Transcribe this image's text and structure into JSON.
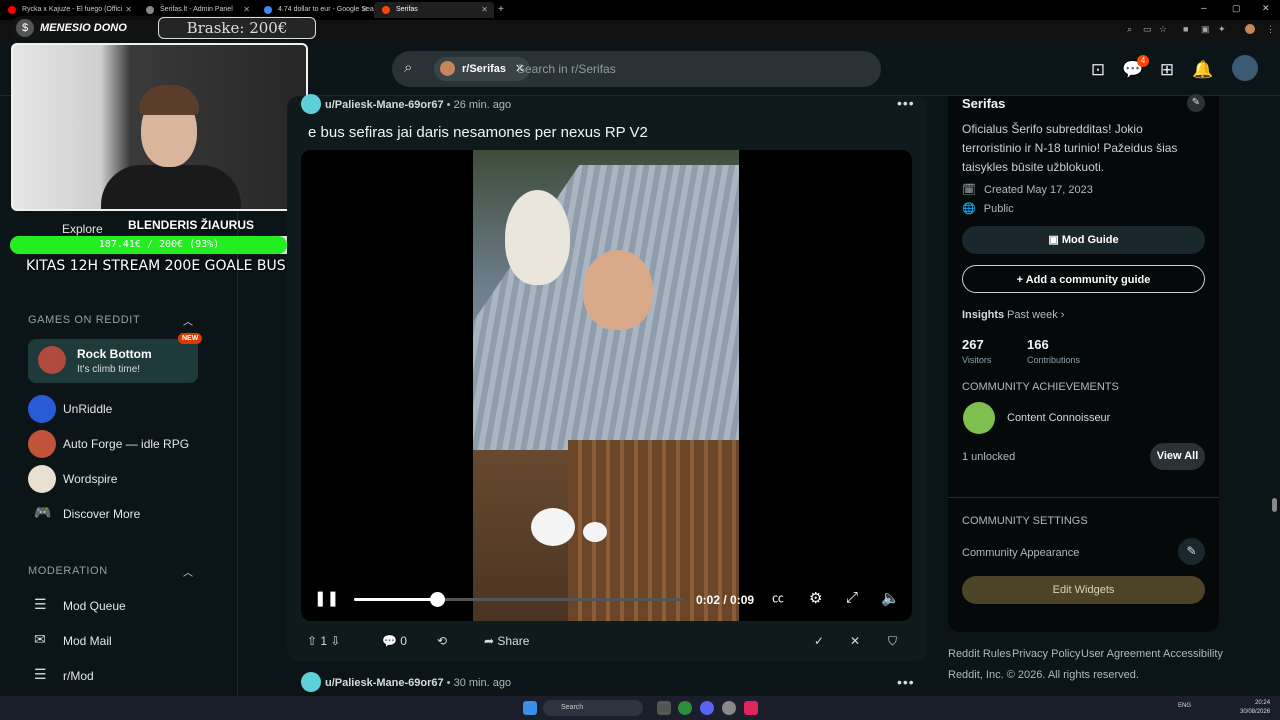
{
  "browser": {
    "tabs": [
      {
        "title": "Rycka x Kajuze - El fuego (Offici",
        "color": "#ff0000"
      },
      {
        "title": "Šerifas.lt - Admin Panel",
        "color": "#888888"
      },
      {
        "title": "4.74 dollar to eur - Google Sea",
        "color": "#4285f4"
      },
      {
        "title": "Serifas",
        "color": "#ff4500"
      }
    ],
    "new_tab": "+"
  },
  "header": {
    "search_chip": "r/Serifas",
    "search_placeholder": "Search in r/Serifas",
    "chat_badge": "4"
  },
  "stream_overlay": {
    "dono_label": "MENESIO DONO",
    "dono_amount": "Braske: 200€",
    "goal_title": "BLENDERIS ŽIAURUS",
    "goal_progress_text": "187.41€ / 200€ (93%)",
    "goal_fraction": 0.93,
    "banner": "KITAS 12H STREAM 200E GOALE BUS"
  },
  "sidebar": {
    "explore_label": "Explore",
    "games_title": "GAMES ON REDDIT",
    "featured_game": {
      "name": "Rock Bottom",
      "subtitle": "It's climb time!",
      "badge": "NEW"
    },
    "games": [
      {
        "name": "UnRiddle",
        "color": "#2a5bd7"
      },
      {
        "name": "Auto Forge — idle RPG",
        "color": "#c0533a"
      },
      {
        "name": "Wordspire",
        "color": "#e8e0d0"
      },
      {
        "name": "Discover More",
        "color": ""
      }
    ],
    "moderation_title": "MODERATION",
    "mod_items": [
      "Mod Queue",
      "Mod Mail",
      "r/Mod"
    ]
  },
  "post": {
    "author": "u/Paliesk-Mane-69or67",
    "time": "26 min. ago",
    "title": "e bus sefiras jai daris nesamones per nexus RP V2",
    "video": {
      "current": "0:02",
      "duration": "0:09",
      "time_text": "0:02 / 0:09",
      "progress": 0.25
    },
    "votes": "1",
    "comments": "0",
    "share_label": "Share"
  },
  "next_post": {
    "author": "u/Paliesk-Mane-69or67",
    "time": "30 min. ago"
  },
  "community": {
    "name": "Serifas",
    "description": "Oficialus Šerifo subredditas! Jokio terroristinio ir N-18 turinio! Pažeidus šias taisykles būsite užblokuoti.",
    "created": "Created May 17, 2023",
    "visibility": "Public",
    "mod_guide": "Mod Guide",
    "add_guide": "Add a community guide",
    "insights_label": "Insights",
    "insights_period": "Past week",
    "visitors": "267",
    "visitors_label": "Visitors",
    "contributions": "166",
    "contributions_label": "Contributions",
    "achievements_title": "COMMUNITY ACHIEVEMENTS",
    "achievement": "Content Connoisseur",
    "unlocked": "1 unlocked",
    "view_all": "View All",
    "settings_title": "COMMUNITY SETTINGS",
    "appearance": "Community Appearance",
    "edit_widgets": "Edit Widgets"
  },
  "footer": {
    "links": [
      "Reddit Rules",
      "Privacy Policy",
      "User Agreement",
      "Accessibility"
    ],
    "copyright": "Reddit, Inc. © 2026. All rights reserved."
  },
  "taskbar": {
    "search": "Search",
    "lang": "ENG",
    "time": "20:24",
    "date": "30/08/2026"
  },
  "colors": {
    "accent": "#ff4500",
    "mod_button": "#1a282d",
    "edit_widgets": "#4d4326"
  }
}
